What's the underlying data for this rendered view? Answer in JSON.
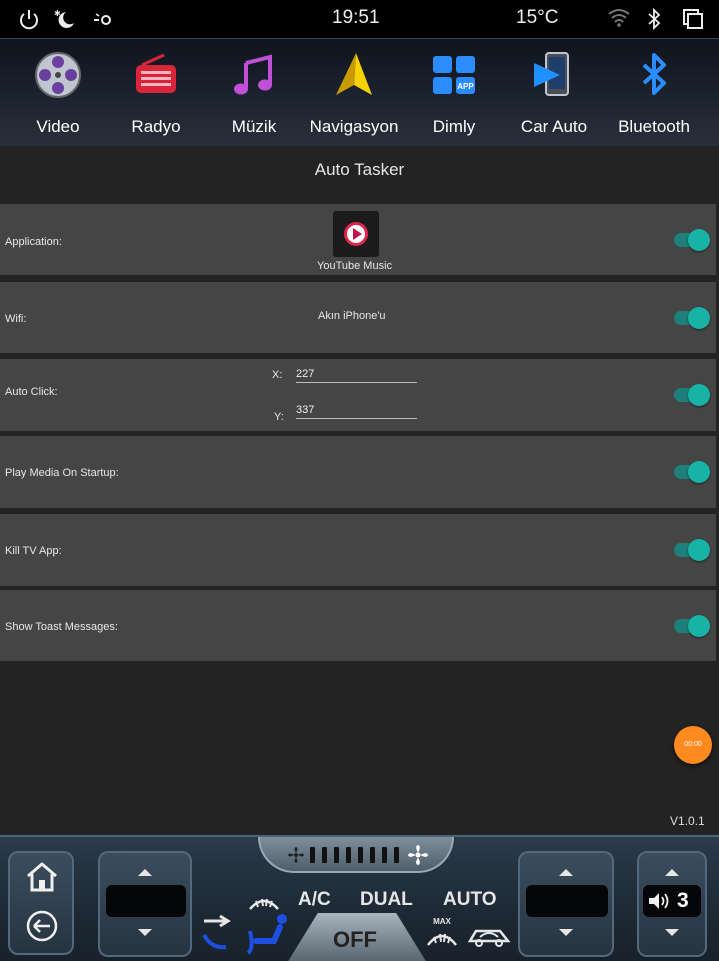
{
  "status_bar": {
    "time": "19:51",
    "temperature": "15°C",
    "icons": [
      "power-icon",
      "night-mode-icon",
      "brightness-icon",
      "wifi-icon",
      "bluetooth-icon",
      "recent-apps-icon"
    ]
  },
  "dock": {
    "apps": [
      {
        "label": "Video",
        "icon": "video-reel-icon"
      },
      {
        "label": "Radyo",
        "icon": "radio-icon"
      },
      {
        "label": "Müzik",
        "icon": "music-note-icon"
      },
      {
        "label": "Navigasyon",
        "icon": "navigation-arrow-icon"
      },
      {
        "label": "Dimly",
        "icon": "app-grid-icon",
        "badge": "APP"
      },
      {
        "label": "Car Auto",
        "icon": "car-auto-phone-icon"
      },
      {
        "label": "Bluetooth",
        "icon": "bluetooth-icon"
      }
    ]
  },
  "page": {
    "title": "Auto Tasker",
    "rows": {
      "application": {
        "label": "Application:",
        "app_name": "YouTube Music",
        "enabled": true
      },
      "wifi": {
        "label": "Wifi:",
        "network": "Akın iPhone'u",
        "enabled": true
      },
      "auto_click": {
        "label": "Auto Click:",
        "x_label": "X:",
        "x_value": "227",
        "y_label": "Y:",
        "y_value": "337",
        "enabled": true
      },
      "play_media": {
        "label": "Play Media On Startup:",
        "enabled": true
      },
      "kill_tv": {
        "label": "Kill TV App:",
        "enabled": true
      },
      "toast": {
        "label": "Show Toast Messages:",
        "enabled": true
      }
    },
    "timer_button": "00:00",
    "version": "V1.0.1"
  },
  "climate": {
    "ac_label": "A/C",
    "dual_label": "DUAL",
    "auto_label": "AUTO",
    "off_label": "OFF",
    "max_label": "MAX",
    "volume_level": "3"
  },
  "colors": {
    "toggle_on": "#17b3a6",
    "row_background": "#454545",
    "timer_button": "#ff8a1e",
    "airflow_blue": "#1f4fe0"
  }
}
